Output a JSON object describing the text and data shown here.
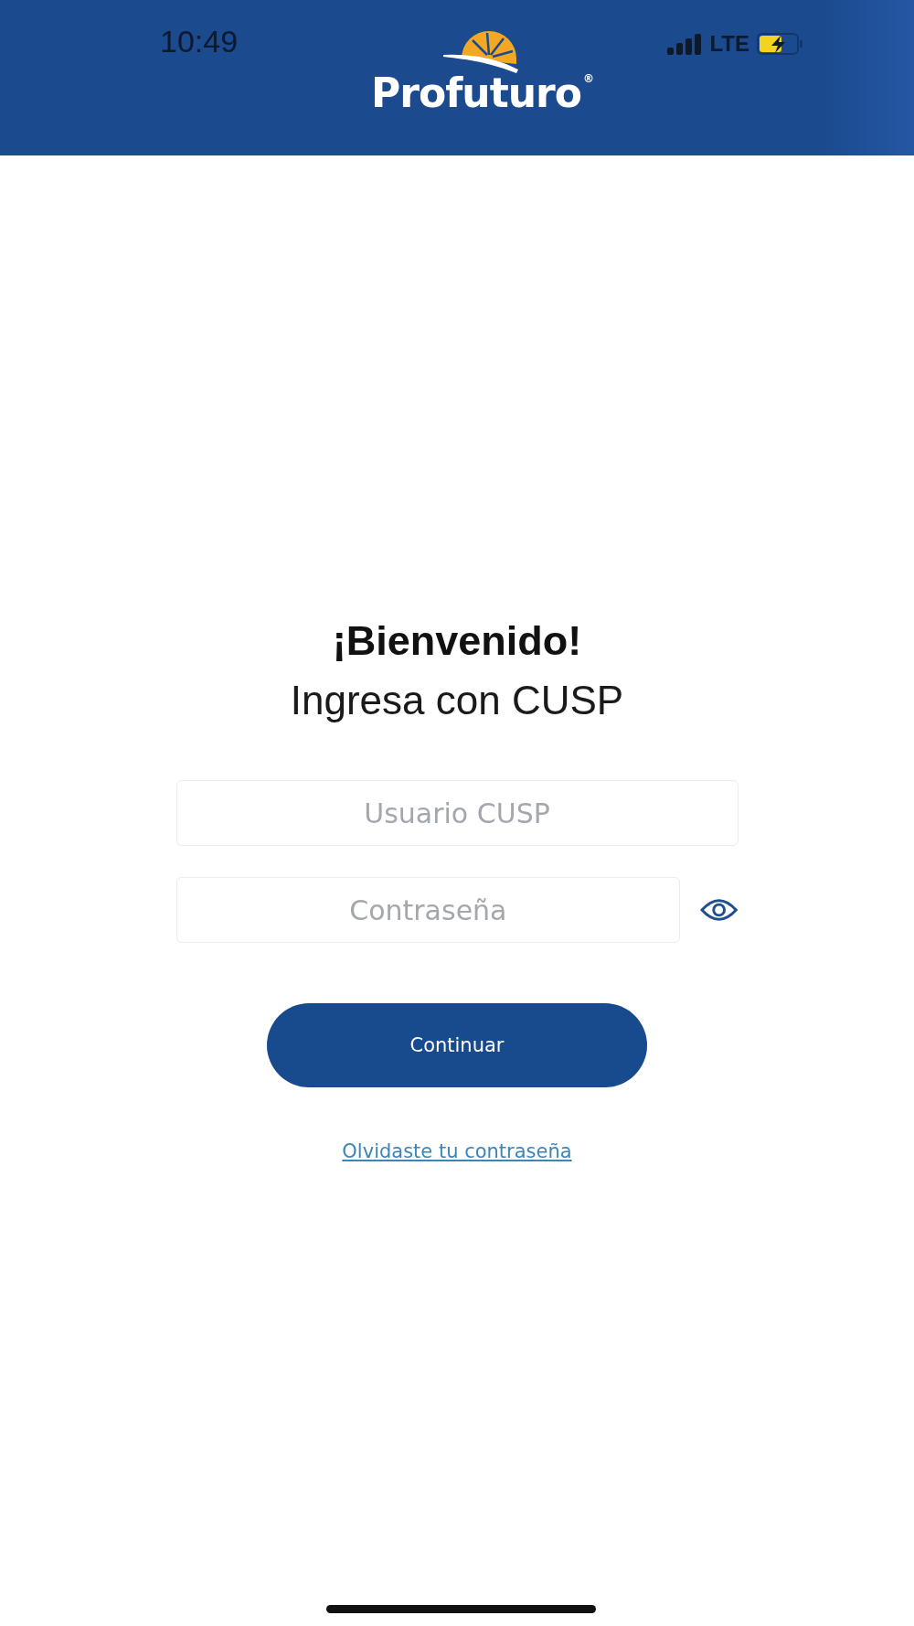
{
  "status_bar": {
    "time": "10:49",
    "network": "LTE",
    "charging": true
  },
  "header": {
    "logo_text": "Profuturo",
    "logo_mark": "®"
  },
  "title": "¡Bienvenido!",
  "subtitle": "Ingresa con CUSP",
  "fields": [
    {
      "kind": "text",
      "placeholder": "Usuario CUSP"
    },
    {
      "kind": "password",
      "placeholder": "Contraseña"
    }
  ],
  "button": "Continuar",
  "link": "Olvidaste tu contraseña"
}
